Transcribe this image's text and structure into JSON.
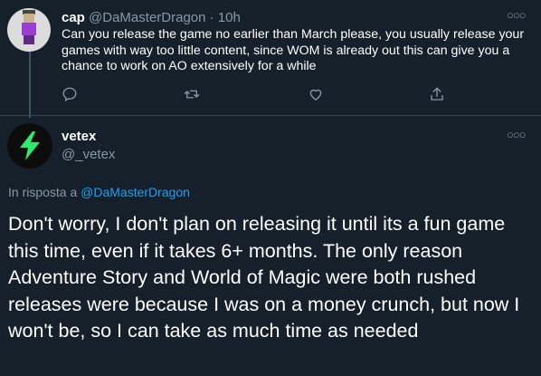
{
  "tweet1": {
    "name": "cap",
    "handle": "@DaMasterDragon",
    "separator": "·",
    "time": "10h",
    "text": "Can you release the game no earlier  than March please, you usually release your games with way too little content, since  WOM is already out this can give you a chance to work on AO extensively for a while",
    "actions": [
      "reply-icon",
      "retweet-icon",
      "like-icon",
      "share-icon"
    ]
  },
  "tweet2": {
    "name": "vetex",
    "handle": "@_vetex",
    "reply_prefix": "In risposta a",
    "reply_mention": "@DaMasterDragon",
    "text": "Don't worry, I don't plan on releasing it until its a fun game this time, even if it takes 6+ months. The only reason Adventure Story and World of Magic were both rushed releases were because I was on a money crunch, but now I won't be, so I can take as much time as needed"
  },
  "colors": {
    "background": "#15202b",
    "text": "#ffffff",
    "muted": "#8899a6",
    "link": "#1da1f2",
    "divider": "#38444d",
    "lightning": "#2ee86f"
  }
}
